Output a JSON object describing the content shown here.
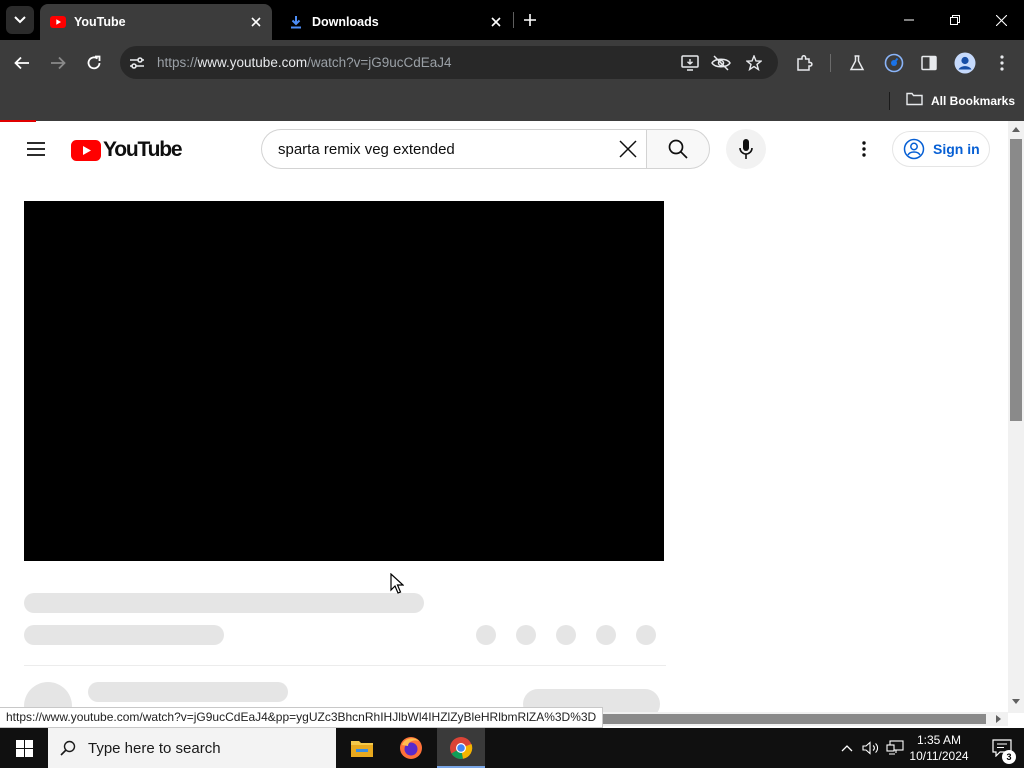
{
  "browser": {
    "tabs": [
      {
        "title": "YouTube",
        "active": true,
        "favicon": "youtube-icon"
      },
      {
        "title": "Downloads",
        "active": false,
        "favicon": "download-icon"
      }
    ],
    "url_prefix": "https://",
    "url_host": "www.youtube.com",
    "url_path": "/watch?v=jG9ucCdEaJ4",
    "bookmarks_label": "All Bookmarks",
    "status_url": "https://www.youtube.com/watch?v=jG9ucCdEaJ4&pp=ygUZc3BhcnRhIHJlbWl4IHZlZyBleHRlbmRlZA%3D%3D"
  },
  "youtube": {
    "logo_text": "YouTube",
    "search_query": "sparta remix veg extended",
    "signin_label": "Sign in",
    "brand_color": "#ff0000",
    "link_color": "#065fd4"
  },
  "taskbar": {
    "search_placeholder": "Type here to search",
    "time": "1:35 AM",
    "date": "10/11/2024",
    "notification_count": "3",
    "apps": [
      "file-explorer-icon",
      "firefox-icon",
      "chrome-icon"
    ]
  }
}
